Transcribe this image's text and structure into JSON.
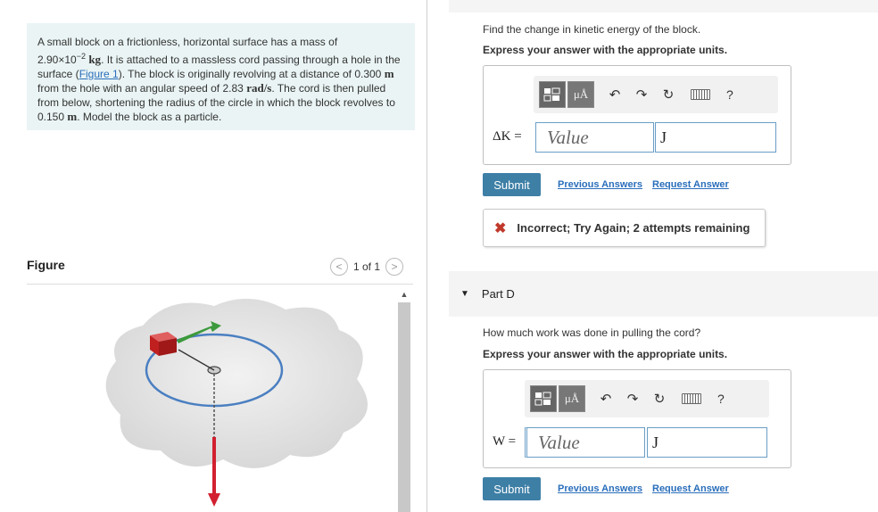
{
  "problem": {
    "intro": "A small block on a frictionless, horizontal surface has a mass of",
    "mass_value": "2.90×10",
    "mass_exp": "−2",
    "mass_unit": "kg",
    "text1": ". It is attached to a massless cord passing through a hole in the surface (",
    "figure_link": "Figure 1",
    "text2": "). The block is originally revolving at a distance of",
    "dist1": "0.300",
    "unit_m": "m",
    "text3": "from the hole with an angular speed of",
    "omega": "2.83",
    "omega_unit": "rad/s",
    "text4": ". The cord is then pulled from below, shortening the radius of the circle in which the block revolves to",
    "dist2": "0.150",
    "text5": ". Model the block as a particle."
  },
  "figure": {
    "title": "Figure",
    "pager_text": "1 of 1",
    "prev_icon": "chevron-left-icon",
    "next_icon": "chevron-right-icon"
  },
  "part_c": {
    "question": "Find the change in kinetic energy of the block.",
    "instruction": "Express your answer with the appropriate units.",
    "eq_label": "ΔK =",
    "value_placeholder": "Value",
    "unit_value": "J",
    "submit_label": "Submit",
    "prev_answers": "Previous Answers",
    "request_answer": "Request Answer",
    "feedback_icon": "✖",
    "feedback_text": "Incorrect; Try Again; 2 attempts remaining"
  },
  "part_d": {
    "label": "Part D",
    "question": "How much work was done in pulling the cord?",
    "instruction": "Express your answer with the appropriate units.",
    "eq_label": "W =",
    "value_placeholder": "Value",
    "unit_value": "J",
    "submit_label": "Submit",
    "prev_answers": "Previous Answers",
    "request_answer": "Request Answer"
  },
  "toolbar": {
    "units_button": "μÅ",
    "help": "?"
  },
  "colors": {
    "submit_bg": "#3e7fa6",
    "link": "#2a6ebb",
    "problem_bg": "#eaf4f4",
    "error": "#c0392b"
  }
}
